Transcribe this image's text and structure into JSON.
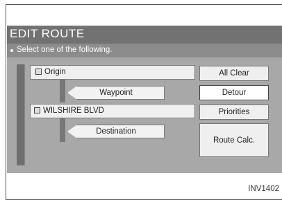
{
  "header": {
    "title": "EDIT ROUTE"
  },
  "instruction": "Select one of the following.",
  "route": {
    "origin": "Origin",
    "waypoint": "Waypoint",
    "street": "WILSHIRE BLVD",
    "destination": "Destination"
  },
  "buttons": {
    "all_clear": "All Clear",
    "detour": "Detour",
    "priorities": "Priorities",
    "route_calc": "Route Calc."
  },
  "figure_code": "INV1402"
}
